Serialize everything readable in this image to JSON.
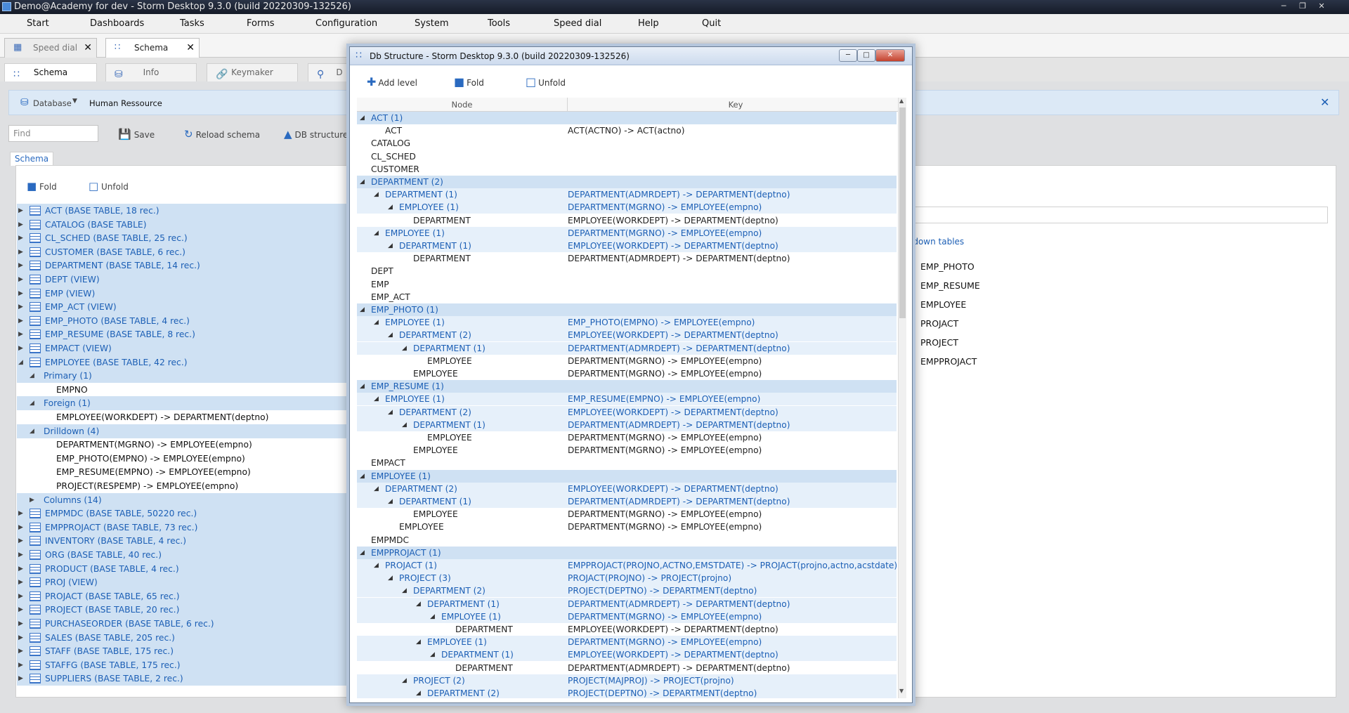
{
  "window": {
    "title": "Demo@Academy for dev - Storm Desktop 9.3.0 (build 20220309-132526)"
  },
  "menu": [
    "Start",
    "Dashboards",
    "Tasks",
    "Forms",
    "Configuration",
    "System",
    "Tools",
    "Speed dial",
    "Help",
    "Quit"
  ],
  "doc_tabs": [
    {
      "label": "Speed dial"
    },
    {
      "label": "Schema"
    }
  ],
  "sub_tabs": [
    {
      "label": "Schema"
    },
    {
      "label": "Info"
    },
    {
      "label": "Keymaker"
    },
    {
      "label": "D"
    }
  ],
  "db_bar": {
    "database_label": "Database",
    "database_value": "Human Ressource"
  },
  "toolbar": {
    "find_placeholder": "Find",
    "save": "Save",
    "reload": "Reload schema",
    "db_structure": "DB structure"
  },
  "schema_tab": "Schema",
  "fold": "Fold",
  "unfold": "Unfold",
  "tree": [
    {
      "text": "ACT (BASE TABLE, 18 rec.)",
      "kind": "table"
    },
    {
      "text": "CATALOG (BASE TABLE)",
      "kind": "table"
    },
    {
      "text": "CL_SCHED (BASE TABLE, 25 rec.)",
      "kind": "table"
    },
    {
      "text": "CUSTOMER (BASE TABLE, 6 rec.)",
      "kind": "table"
    },
    {
      "text": "DEPARTMENT (BASE TABLE, 14 rec.)",
      "kind": "table"
    },
    {
      "text": "DEPT (VIEW)",
      "kind": "table"
    },
    {
      "text": "EMP (VIEW)",
      "kind": "table"
    },
    {
      "text": "EMP_ACT (VIEW)",
      "kind": "table"
    },
    {
      "text": "EMP_PHOTO (BASE TABLE, 4 rec.)",
      "kind": "table"
    },
    {
      "text": "EMP_RESUME (BASE TABLE, 8 rec.)",
      "kind": "table"
    },
    {
      "text": "EMPACT (VIEW)",
      "kind": "table"
    },
    {
      "text": "EMPLOYEE (BASE TABLE, 42 rec.)",
      "kind": "table-open"
    },
    {
      "text": "Primary (1)",
      "kind": "group"
    },
    {
      "text": "EMPNO",
      "kind": "leaf"
    },
    {
      "text": "Foreign (1)",
      "kind": "group"
    },
    {
      "text": "EMPLOYEE(WORKDEPT) -> DEPARTMENT(deptno)",
      "kind": "leaf"
    },
    {
      "text": "Drilldown (4)",
      "kind": "group"
    },
    {
      "text": "DEPARTMENT(MGRNO) -> EMPLOYEE(empno)",
      "kind": "leaf"
    },
    {
      "text": "EMP_PHOTO(EMPNO) -> EMPLOYEE(empno)",
      "kind": "leaf"
    },
    {
      "text": "EMP_RESUME(EMPNO) -> EMPLOYEE(empno)",
      "kind": "leaf"
    },
    {
      "text": "PROJECT(RESPEMP) -> EMPLOYEE(empno)",
      "kind": "leaf"
    },
    {
      "text": "Columns (14)",
      "kind": "group-closed"
    },
    {
      "text": "EMPMDC (BASE TABLE, 50220 rec.)",
      "kind": "table"
    },
    {
      "text": "EMPPROJACT (BASE TABLE, 73 rec.)",
      "kind": "table"
    },
    {
      "text": "INVENTORY (BASE TABLE, 4 rec.)",
      "kind": "table"
    },
    {
      "text": "ORG (BASE TABLE, 40 rec.)",
      "kind": "table"
    },
    {
      "text": "PRODUCT (BASE TABLE, 4 rec.)",
      "kind": "table"
    },
    {
      "text": "PROJ (VIEW)",
      "kind": "table"
    },
    {
      "text": "PROJACT (BASE TABLE, 65 rec.)",
      "kind": "table"
    },
    {
      "text": "PROJECT (BASE TABLE, 20 rec.)",
      "kind": "table"
    },
    {
      "text": "PURCHASEORDER (BASE TABLE, 6 rec.)",
      "kind": "table"
    },
    {
      "text": "SALES (BASE TABLE, 205 rec.)",
      "kind": "table"
    },
    {
      "text": "STAFF (BASE TABLE, 175 rec.)",
      "kind": "table"
    },
    {
      "text": "STAFFG (BASE TABLE, 175 rec.)",
      "kind": "table"
    },
    {
      "text": "SUPPLIERS (BASE TABLE, 2 rec.)",
      "kind": "table"
    }
  ],
  "right_panel": {
    "drilldown_label": "ldown tables",
    "items": [
      "EMP_PHOTO",
      "EMP_RESUME",
      "EMPLOYEE",
      "PROJACT",
      "PROJECT",
      "EMPPROJACT"
    ]
  },
  "dialog": {
    "title": "Db Structure -  Storm Desktop 9.3.0 (build 20220309-132526)",
    "add_level": "Add level",
    "fold": "Fold",
    "unfold": "Unfold",
    "col_node": "Node",
    "col_key": "Key",
    "rows": [
      {
        "d": 0,
        "n": "ACT (1)",
        "k": "",
        "t": "g",
        "a": 1
      },
      {
        "d": 1,
        "n": "ACT",
        "k": "ACT(ACTNO) -> ACT(actno)",
        "t": "l",
        "a": 0
      },
      {
        "d": 0,
        "n": "CATALOG",
        "k": "",
        "t": "l",
        "a": 0
      },
      {
        "d": 0,
        "n": "CL_SCHED",
        "k": "",
        "t": "l",
        "a": 0
      },
      {
        "d": 0,
        "n": "CUSTOMER",
        "k": "",
        "t": "l",
        "a": 0
      },
      {
        "d": 0,
        "n": "DEPARTMENT (2)",
        "k": "",
        "t": "g",
        "a": 1
      },
      {
        "d": 1,
        "n": "DEPARTMENT (1)",
        "k": "DEPARTMENT(ADMRDEPT) -> DEPARTMENT(deptno)",
        "t": "s",
        "a": 1
      },
      {
        "d": 2,
        "n": "EMPLOYEE (1)",
        "k": "DEPARTMENT(MGRNO) -> EMPLOYEE(empno)",
        "t": "s",
        "a": 1
      },
      {
        "d": 3,
        "n": "DEPARTMENT",
        "k": "EMPLOYEE(WORKDEPT) -> DEPARTMENT(deptno)",
        "t": "l",
        "a": 0
      },
      {
        "d": 1,
        "n": "EMPLOYEE (1)",
        "k": "DEPARTMENT(MGRNO) -> EMPLOYEE(empno)",
        "t": "s",
        "a": 1
      },
      {
        "d": 2,
        "n": "DEPARTMENT (1)",
        "k": "EMPLOYEE(WORKDEPT) -> DEPARTMENT(deptno)",
        "t": "s",
        "a": 1
      },
      {
        "d": 3,
        "n": "DEPARTMENT",
        "k": "DEPARTMENT(ADMRDEPT) -> DEPARTMENT(deptno)",
        "t": "l",
        "a": 0
      },
      {
        "d": 0,
        "n": "DEPT",
        "k": "",
        "t": "l",
        "a": 0
      },
      {
        "d": 0,
        "n": "EMP",
        "k": "",
        "t": "l",
        "a": 0
      },
      {
        "d": 0,
        "n": "EMP_ACT",
        "k": "",
        "t": "l",
        "a": 0
      },
      {
        "d": 0,
        "n": "EMP_PHOTO (1)",
        "k": "",
        "t": "g",
        "a": 1
      },
      {
        "d": 1,
        "n": "EMPLOYEE (1)",
        "k": "EMP_PHOTO(EMPNO) -> EMPLOYEE(empno)",
        "t": "s",
        "a": 1
      },
      {
        "d": 2,
        "n": "DEPARTMENT (2)",
        "k": "EMPLOYEE(WORKDEPT) -> DEPARTMENT(deptno)",
        "t": "s",
        "a": 1
      },
      {
        "d": 3,
        "n": "DEPARTMENT (1)",
        "k": "DEPARTMENT(ADMRDEPT) -> DEPARTMENT(deptno)",
        "t": "s",
        "a": 1
      },
      {
        "d": 4,
        "n": "EMPLOYEE",
        "k": "DEPARTMENT(MGRNO) -> EMPLOYEE(empno)",
        "t": "l",
        "a": 0
      },
      {
        "d": 3,
        "n": "EMPLOYEE",
        "k": "DEPARTMENT(MGRNO) -> EMPLOYEE(empno)",
        "t": "l",
        "a": 0
      },
      {
        "d": 0,
        "n": "EMP_RESUME (1)",
        "k": "",
        "t": "g",
        "a": 1
      },
      {
        "d": 1,
        "n": "EMPLOYEE (1)",
        "k": "EMP_RESUME(EMPNO) -> EMPLOYEE(empno)",
        "t": "s",
        "a": 1
      },
      {
        "d": 2,
        "n": "DEPARTMENT (2)",
        "k": "EMPLOYEE(WORKDEPT) -> DEPARTMENT(deptno)",
        "t": "s",
        "a": 1
      },
      {
        "d": 3,
        "n": "DEPARTMENT (1)",
        "k": "DEPARTMENT(ADMRDEPT) -> DEPARTMENT(deptno)",
        "t": "s",
        "a": 1
      },
      {
        "d": 4,
        "n": "EMPLOYEE",
        "k": "DEPARTMENT(MGRNO) -> EMPLOYEE(empno)",
        "t": "l",
        "a": 0
      },
      {
        "d": 3,
        "n": "EMPLOYEE",
        "k": "DEPARTMENT(MGRNO) -> EMPLOYEE(empno)",
        "t": "l",
        "a": 0
      },
      {
        "d": 0,
        "n": "EMPACT",
        "k": "",
        "t": "l",
        "a": 0
      },
      {
        "d": 0,
        "n": "EMPLOYEE (1)",
        "k": "",
        "t": "g",
        "a": 1
      },
      {
        "d": 1,
        "n": "DEPARTMENT (2)",
        "k": "EMPLOYEE(WORKDEPT) -> DEPARTMENT(deptno)",
        "t": "s",
        "a": 1
      },
      {
        "d": 2,
        "n": "DEPARTMENT (1)",
        "k": "DEPARTMENT(ADMRDEPT) -> DEPARTMENT(deptno)",
        "t": "s",
        "a": 1
      },
      {
        "d": 3,
        "n": "EMPLOYEE",
        "k": "DEPARTMENT(MGRNO) -> EMPLOYEE(empno)",
        "t": "l",
        "a": 0
      },
      {
        "d": 2,
        "n": "EMPLOYEE",
        "k": "DEPARTMENT(MGRNO) -> EMPLOYEE(empno)",
        "t": "l",
        "a": 0
      },
      {
        "d": 0,
        "n": "EMPMDC",
        "k": "",
        "t": "l",
        "a": 0
      },
      {
        "d": 0,
        "n": "EMPPROJACT (1)",
        "k": "",
        "t": "g",
        "a": 1
      },
      {
        "d": 1,
        "n": "PROJACT (1)",
        "k": "EMPPROJACT(PROJNO,ACTNO,EMSTDATE) -> PROJACT(projno,actno,acstdate)",
        "t": "s",
        "a": 1
      },
      {
        "d": 2,
        "n": "PROJECT (3)",
        "k": "PROJACT(PROJNO) -> PROJECT(projno)",
        "t": "s",
        "a": 1
      },
      {
        "d": 3,
        "n": "DEPARTMENT (2)",
        "k": "PROJECT(DEPTNO) -> DEPARTMENT(deptno)",
        "t": "s",
        "a": 1
      },
      {
        "d": 4,
        "n": "DEPARTMENT (1)",
        "k": "DEPARTMENT(ADMRDEPT) -> DEPARTMENT(deptno)",
        "t": "s",
        "a": 1
      },
      {
        "d": 5,
        "n": "EMPLOYEE (1)",
        "k": "DEPARTMENT(MGRNO) -> EMPLOYEE(empno)",
        "t": "s",
        "a": 1
      },
      {
        "d": 6,
        "n": "DEPARTMENT",
        "k": "EMPLOYEE(WORKDEPT) -> DEPARTMENT(deptno)",
        "t": "l",
        "a": 0
      },
      {
        "d": 4,
        "n": "EMPLOYEE (1)",
        "k": "DEPARTMENT(MGRNO) -> EMPLOYEE(empno)",
        "t": "s",
        "a": 1
      },
      {
        "d": 5,
        "n": "DEPARTMENT (1)",
        "k": "EMPLOYEE(WORKDEPT) -> DEPARTMENT(deptno)",
        "t": "s",
        "a": 1
      },
      {
        "d": 6,
        "n": "DEPARTMENT",
        "k": "DEPARTMENT(ADMRDEPT) -> DEPARTMENT(deptno)",
        "t": "l",
        "a": 0
      },
      {
        "d": 3,
        "n": "PROJECT (2)",
        "k": "PROJECT(MAJPROJ) -> PROJECT(projno)",
        "t": "s",
        "a": 1
      },
      {
        "d": 4,
        "n": "DEPARTMENT (2)",
        "k": "PROJECT(DEPTNO) -> DEPARTMENT(deptno)",
        "t": "s",
        "a": 1
      }
    ]
  },
  "colors": {
    "accent": "#1c5fb5",
    "highlight": "#cfe1f3",
    "subhighlight": "#e6f0fa"
  }
}
